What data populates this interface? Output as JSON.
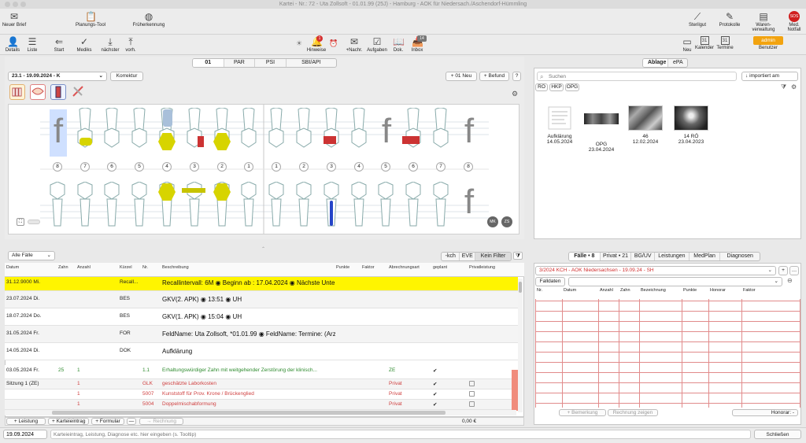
{
  "window_title": "Kartei - Nr.: 72 - Uta Zollsoft - 01.01.99 (25J) - Hamburg - AOK für Niedersach./Aschendorf-Hümmling",
  "toolbar_top": {
    "neuer_brief": "Neuer Brief",
    "planungs_tool": "Planungs-Tool",
    "frueherkennung": "Früherkennung",
    "sterilgut": "Sterilgut",
    "protokolle": "Protokolle",
    "warenverwaltung_1": "Waren-",
    "warenverwaltung_2": "verwaltung",
    "med_notfall_1": "Med.",
    "med_notfall_2": "Notfall",
    "sos": "SOS"
  },
  "toolbar_second": {
    "details": "Details",
    "liste": "Liste",
    "start": "Start",
    "mediks": "Mediks",
    "naechster": "nächster",
    "vorh": "vorh.",
    "hinweise": "Hinweise",
    "hinweise_badge": "1",
    "nachr": "+Nachr.",
    "aufgaben": "Aufgaben",
    "dok": "Dok.",
    "inbox": "Inbox",
    "inbox_badge": "14",
    "neu": "Neu",
    "kalender": "Kalender",
    "kalender_day": "31",
    "termine": "Termine",
    "termine_day": "31",
    "benutzer": "Benutzer",
    "admin": "admin"
  },
  "chart_tabs": [
    "01",
    "PAR",
    "PSI",
    "SBI/API"
  ],
  "befund_select": "23.1 - 19.09.2024 - K",
  "korrektur": "Korrektur",
  "neu_01": "+ 01 Neu",
  "befund": "+ Befund",
  "help": "?",
  "upper_numbers": [
    "8",
    "7",
    "6",
    "5",
    "4",
    "3",
    "2",
    "1",
    "1",
    "2",
    "3",
    "4",
    "5",
    "6",
    "7",
    "8"
  ],
  "f_mark": "f",
  "mk": "MK",
  "zs": "ZS",
  "right_tabs": [
    "Ablage",
    "ePA"
  ],
  "search_placeholder": "Suchen",
  "sort_select": "importiert am",
  "filter_chips": [
    "RÖ",
    "HKP",
    "OPG"
  ],
  "thumbnails": [
    {
      "label": "Aufklärung",
      "date": "14.05.2024"
    },
    {
      "label": "OPG",
      "date": "23.04.2024"
    },
    {
      "label": "46",
      "date": "12.02.2024"
    },
    {
      "label": "14 RÖ",
      "date": "23.04.2023"
    }
  ],
  "faelle_select": "Alle Fälle",
  "filter_buttons": [
    "-kch",
    "EVE",
    "Kein Filter"
  ],
  "table_headers": [
    "Datum",
    "Zahn",
    "Anzahl",
    "Kürzel",
    "Nr.",
    "Beschreibung",
    "Punkte",
    "Faktor",
    "Abrechnungsart",
    "geplant",
    "Privatleistung"
  ],
  "rows": [
    {
      "datum": "31.12.9000 Mi.",
      "kuerzel": "Recall...",
      "text": "Recallintervall: 6M ◉ Beginn ab : 17.04.2024 ◉ Nächste Unte..."
    },
    {
      "datum": "23.07.2024 Di.",
      "kuerzel": "BES",
      "text": "GKV(2. APK) ◉ 13:51 ◉ UH"
    },
    {
      "datum": "18.07.2024 Do.",
      "kuerzel": "BES",
      "text": "GKV(1. APK) ◉ 15:04 ◉ UH"
    },
    {
      "datum": "31.05.2024 Fr.",
      "kuerzel": "FOR",
      "text": "FeldName: Uta Zollsoft, *01.01.99 ◉ FeldName: Termine: (Arz..."
    },
    {
      "datum": "14.05.2024 Di.",
      "kuerzel": "DOK",
      "text": "Aufklärung"
    },
    {
      "datum": "03.05.2024 Fr.",
      "zahn": "25",
      "anzahl": "1",
      "nr": "1.1",
      "text": "Erhaltungswürdiger Zahn mit weitgehender Zerstörung der klinisch...",
      "abr": "ZE",
      "check": "✔"
    },
    {
      "datum": "Sitzung 1 (ZE)",
      "anzahl": "1",
      "nr": "GLK",
      "text": "geschätzte Laborkosten",
      "abr": "Privat",
      "check": "✔"
    },
    {
      "anzahl": "1",
      "nr": "5007",
      "text": "Kunststoff für Prov. Krone / Brückenglied",
      "abr": "Privat",
      "check": "✔"
    },
    {
      "anzahl": "1",
      "nr": "5004",
      "text": "Doppelmischabformung",
      "abr": "Privat",
      "check": "✔"
    }
  ],
  "bottom_left": {
    "leistung": "+ Leistung",
    "karteieintrag": "+ Karteieintrag",
    "formular": "+ Formular",
    "minus": "—",
    "rechnung": "Rechnung",
    "sum": "0,00 €"
  },
  "right_bottom_tabs": [
    "Fälle • 8",
    "Privat • 21",
    "BG/UV",
    "Leistungen",
    "MedPlan",
    "Diagnosen"
  ],
  "fall_select": "3/2024 KCH - AOK Niedersachsen - 19.09.24 - SH",
  "falldaten": "Falldaten",
  "right_headers": [
    "Nr.",
    "Datum",
    "Anzahl",
    "Zahn",
    "Bezeichnung",
    "Punkte",
    "Honorar",
    "Faktor"
  ],
  "bemerkung": "+ Bemerkung",
  "rechnung_zeigen": "Rechnung zeigen",
  "honorar": "Honorar: -",
  "date_input": "19.09.2024",
  "entry_placeholder": "Karteieintrag, Leistung, Diagnose etc. hier eingeben (s. Tooltip)",
  "schliessen": "Schließen"
}
